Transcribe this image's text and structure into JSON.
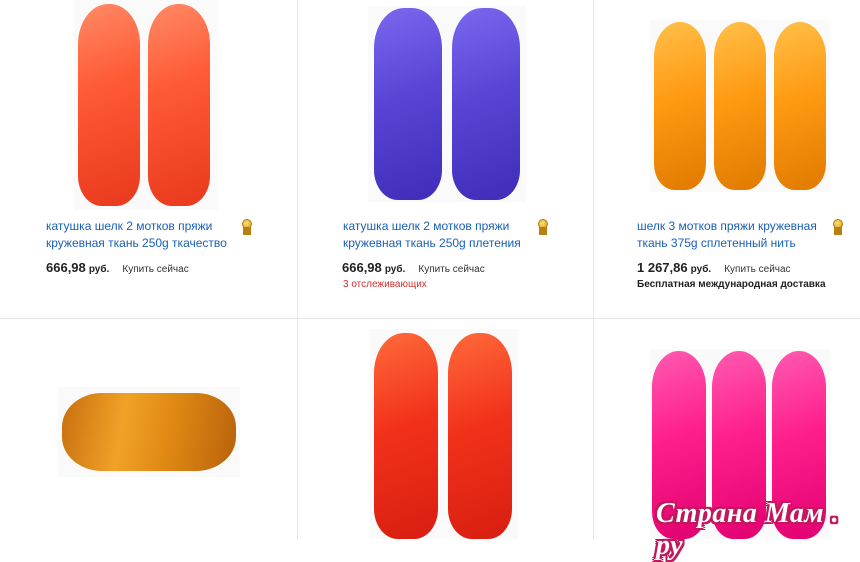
{
  "listings": [
    {
      "title": "катушка шелк 2 мотков пряжи кружевная ткань 250g ткачество",
      "price": "666,98",
      "currency": "руб.",
      "action": "Купить сейчас",
      "badge": "medal-icon",
      "skein_count": 2,
      "color": "#ff5a36"
    },
    {
      "title": "катушка шелк 2 мотков пряжи кружевная ткань 250g плетения",
      "price": "666,98",
      "currency": "руб.",
      "action": "Купить сейчас",
      "watchers": "3 отслеживающих",
      "badge": "medal-icon",
      "skein_count": 2,
      "color": "#5a44d6"
    },
    {
      "title": "шелк 3 мотков пряжи кружевная ткань 375g сплетенный нить",
      "price": "1 267,86",
      "currency": "руб.",
      "action": "Купить сейчас",
      "shipping": "Бесплатная международная доставка",
      "badge": "medal-icon",
      "skein_count": 3,
      "color": "#ff9a12"
    },
    {
      "skein_count": 1,
      "color": "#e08a14"
    },
    {
      "skein_count": 2,
      "color": "#f2311b"
    },
    {
      "skein_count": 3,
      "color": "#ff1f8c"
    }
  ],
  "watermark": "Страна Мам . ру"
}
